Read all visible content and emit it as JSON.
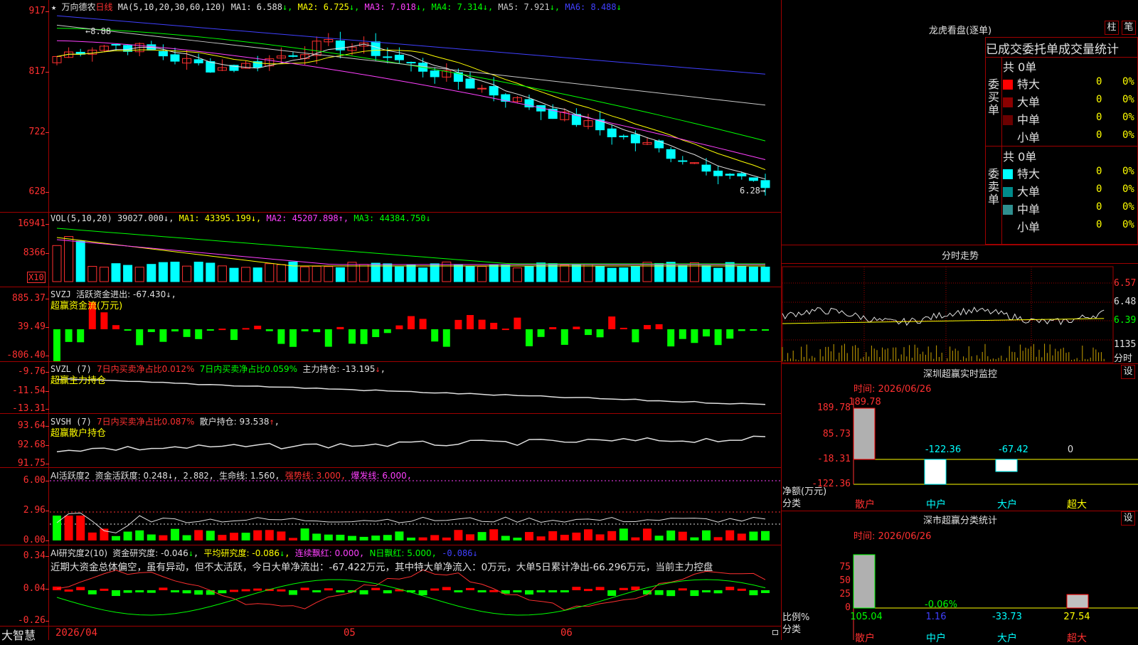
{
  "stock": {
    "name": "万向德农",
    "period": "日线",
    "star": "★"
  },
  "main": {
    "ma_header": "MA(5,10,20,30,60,120)",
    "ma": [
      {
        "t": "MA1: 6.588",
        "a": "↓",
        "c": "#e0e0e0"
      },
      {
        "t": "MA2: 6.725",
        "a": "↓",
        "c": "#ffff00"
      },
      {
        "t": "MA3: 7.018",
        "a": "↓",
        "c": "#ff40ff"
      },
      {
        "t": "MA4: 7.314",
        "a": "↓",
        "c": "#00ff00"
      },
      {
        "t": "MA5: 7.921",
        "a": "↓",
        "c": "#c8c8c8"
      },
      {
        "t": "MA6: 8.488",
        "a": "↓",
        "c": "#4040ff"
      }
    ],
    "y_labels": [
      "917",
      "817",
      "722",
      "628"
    ],
    "high_label": "8.88",
    "low_label": "6.28"
  },
  "vol": {
    "header": "VOL(5,10,20)",
    "v": "39027.000",
    "ma1": "MA1: 43395.199",
    "ma2": "MA2: 45207.898",
    "ma3": "MA3: 44384.750",
    "y_labels": [
      "16941",
      "8366"
    ],
    "unit": "X10"
  },
  "svzj": {
    "name": "SVZJ",
    "t1": "活跃资金进出: -67.430",
    "a1": "↓",
    "sub": "超赢资金流(万元)",
    "y_labels": [
      "885.37",
      "39.49",
      "-806.40"
    ]
  },
  "svzl": {
    "name": "SVZL (7)",
    "t1": "7日内买卖净占比0.012%",
    "t2": "7日内买卖净占比0.059%",
    "t3": "主力持仓: -13.195",
    "sub": "超赢主力持仓",
    "y_labels": [
      "-9.76",
      "-11.54",
      "-13.31"
    ]
  },
  "svsh": {
    "name": "SVSH (7)",
    "t1": "7日内买卖净占比0.087%",
    "t2": "散户持仓: 93.538",
    "sub": "超赢散户持仓",
    "y_labels": [
      "93.64",
      "92.68",
      "91.75"
    ]
  },
  "ai1": {
    "name": "AI活跃度2",
    "t1": "资金活跃度: 0.248",
    "v2": "2.882",
    "t3": "生命线: 1.560",
    "t4": "强势线: 3.000",
    "t5": "爆发线: 6.000",
    "y_labels": [
      "6.00",
      "2.96",
      "0.00"
    ]
  },
  "ai2": {
    "name": "AI研究度2(10)",
    "t1": "资金研究度: -0.046",
    "t2": "平均研究度: -0.086",
    "t3": "连续飘红: 0.000",
    "t4": "N日飘红: 5.000",
    "t5": "-0.086",
    "y_labels": [
      "0.34",
      "0.04",
      "-0.26"
    ],
    "comment": "近期大资金总体偏空，虽有异动，但不太活跃，今日大单净流出：-67.422万元，其中特大单净流入：0万元，大单5日累计净出-66.296万元，当前主力控盘"
  },
  "xaxis": {
    "logo": "大智慧",
    "labels": [
      "2026/04",
      "05",
      "06"
    ]
  },
  "right": {
    "lh": {
      "title": "龙虎看盘(逐单)",
      "btn1": "柱",
      "btn2": "笔",
      "tabs": "已成交委托单成交量统计",
      "buy": {
        "label": "委买单",
        "total": "共 0单",
        "rows": [
          {
            "n": "特大",
            "v": "0",
            "p": "0%",
            "c": "#ff0000"
          },
          {
            "n": "大单",
            "v": "0",
            "p": "0%",
            "c": "#8b0000"
          },
          {
            "n": "中单",
            "v": "0",
            "p": "0%",
            "c": "#6b0000"
          },
          {
            "n": "小单",
            "v": "0",
            "p": "0%",
            "c": "#000000"
          }
        ]
      },
      "sell": {
        "label": "委卖单",
        "total": "共 0单",
        "rows": [
          {
            "n": "特大",
            "v": "0",
            "p": "0%",
            "c": "#00ffff"
          },
          {
            "n": "大单",
            "v": "0",
            "p": "0%",
            "c": "#008b8b"
          },
          {
            "n": "中单",
            "v": "0",
            "p": "0%",
            "c": "#2f8f8f"
          },
          {
            "n": "小单",
            "v": "0",
            "p": "0%",
            "c": "#000000"
          }
        ]
      }
    },
    "fs": {
      "title": "分时走势",
      "y_labels": [
        "6.57",
        "6.48",
        "6.39"
      ],
      "vol_label": "1135",
      "unit": "分时"
    },
    "sz": {
      "title": "深圳超赢实时监控",
      "btn": "设",
      "time": "时间: 2026/06/26",
      "y_labels": [
        "189.78",
        "85.73",
        "-18.31",
        "-122.36"
      ],
      "unit": "净额(万元)",
      "cat_label": "分类",
      "bars": [
        {
          "n": "散户",
          "v": "189.78"
        },
        {
          "n": "中户",
          "v": "-122.36"
        },
        {
          "n": "大户",
          "v": "-67.42"
        },
        {
          "n": "超大",
          "v": "0"
        }
      ]
    },
    "cls": {
      "title": "深市超赢分类统计",
      "btn": "设",
      "time": "时间: 2026/06/26",
      "y_labels": [
        "75",
        "50",
        "25",
        "0"
      ],
      "unit": "比例%",
      "cat_label": "分类",
      "bars": [
        {
          "n": "散户",
          "v": "105.04"
        },
        {
          "n": "中户",
          "v": "1.16",
          "top": "-0.06%"
        },
        {
          "n": "大户",
          "v": "-33.73"
        },
        {
          "n": "超大",
          "v": "27.54"
        }
      ]
    }
  }
}
